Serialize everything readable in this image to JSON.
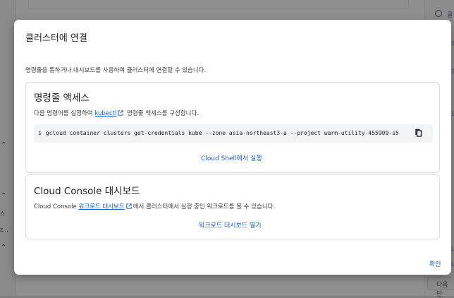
{
  "background": {
    "left_items": [
      "스",
      "z..."
    ],
    "right_button": "다음 단",
    "right_labels": [
      "클",
      "리",
      "리",
      "리",
      "나",
      "나"
    ]
  },
  "dialog": {
    "title": "클러스터에 연결",
    "description": "명령줄을 통하거나 대시보드를 사용하여 클러스터에 연결할 수 있습니다.",
    "cli": {
      "title": "명령줄 액세스",
      "desc_prefix": "다음 명령어를 실행하여 ",
      "link": "kubectl",
      "desc_suffix": " 명령줄 액세스를 구성합니다.",
      "prompt": "$",
      "command": "gcloud container clusters get-credentials kube --zone asia-northeast3-a --project warm-utility-455909-s5",
      "run_button": "Cloud Shell에서 실행"
    },
    "console": {
      "title": "Cloud Console 대시보드",
      "desc_prefix": "Cloud Console ",
      "link": "워크로드 대시보드",
      "desc_suffix": "에서 클러스터에서 실행 중인 워크로드를 볼 수 있습니다.",
      "open_button": "워크로드 대시보드 열기"
    },
    "confirm_button": "확인"
  },
  "colors": {
    "accent": "#1a5fc0",
    "scrim": "#8e8e8e"
  }
}
